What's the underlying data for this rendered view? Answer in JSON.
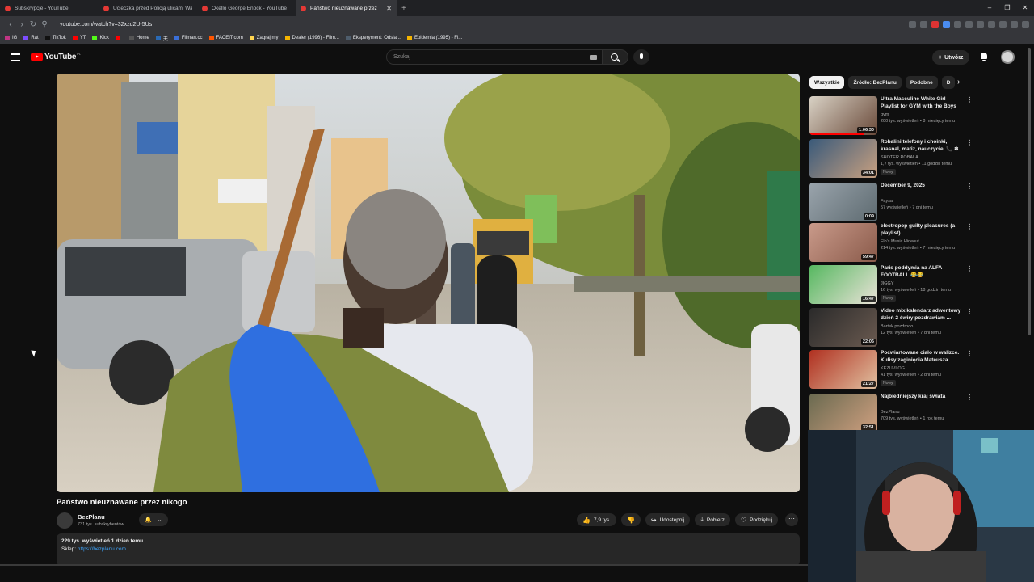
{
  "browser": {
    "tabs": [
      {
        "title": "Subskrypcje - YouTube",
        "active": false
      },
      {
        "title": "Ucieczka przed Policją ulicami Warsz",
        "active": false
      },
      {
        "title": "Okello George Enock - YouTube",
        "active": false
      },
      {
        "title": "Państwo nieuznawane przez",
        "active": true
      }
    ],
    "new_tab_symbol": "+",
    "window_controls": [
      "–",
      "❐",
      "✕"
    ],
    "url": "youtube.com/watch?v=32xzd2U-5Us",
    "bookmarks": [
      "IG",
      "Rat",
      "TikTok",
      "YT",
      "Kick",
      "",
      "Home",
      "天",
      "Filman.cc",
      "FACEIT.com",
      "Zagraj.my",
      "Dealer (1996) - Film...",
      "Eksperyment: Odsia...",
      "Epidemia (1995) - Fi..."
    ],
    "bookmark_colors": [
      "#c13584",
      "#7c4dff",
      "#111111",
      "#ff0000",
      "#53fc18",
      "#ff0000",
      "#555555",
      "#2a6ab5",
      "#3a6fd8",
      "#ff5500",
      "#ffd54f",
      "#f4b400",
      "#4e5d6c",
      "#f4b400"
    ]
  },
  "youtube": {
    "logo_text": "YouTube",
    "country": "PL",
    "search_placeholder": "Szukaj",
    "create_label": "Utwórz"
  },
  "video": {
    "title": "Państwo nieuznawane przez nikogo",
    "channel": "BezPlanu",
    "subscribers": "731 tys. subskrybentów",
    "likes": "7,9 tys.",
    "share_label": "Udostępnij",
    "download_label": "Pobierz",
    "thanks_label": "Podziękuj",
    "description_meta": "229 tys. wyświetleń  1 dzień temu",
    "shop_label": "Sklep:",
    "shop_link": "https://bezplanu.com"
  },
  "sidebar": {
    "chips": [
      "Wszystkie",
      "Źródło: BezPlanu",
      "Podobne",
      "D"
    ],
    "recommendations": [
      {
        "title": "Ultra Masculine White Girl Playlist for GYM with the Boys",
        "channel": "gym",
        "meta": "200 tys. wyświetleń • 8 miesięcy temu",
        "duration": "1:06:30",
        "badge": "",
        "watched_fraction": 0.8,
        "thumb_colors": [
          "#d9d2c5",
          "#6a4a3a"
        ]
      },
      {
        "title": "Robalini telefony i choinki, krasnal, matiz, nauczyciel 📞 ❄",
        "channel": "SHOTER ROBALA",
        "meta": "1,7 tys. wyświetleń • 11 godzin temu",
        "duration": "34:01",
        "badge": "Nowy",
        "watched_fraction": 0,
        "thumb_colors": [
          "#3a5a7a",
          "#c8a080"
        ]
      },
      {
        "title": "December 9, 2025",
        "channel": "Faysal",
        "meta": "57 wyświetleń • 7 dni temu",
        "duration": "0:09",
        "badge": "",
        "watched_fraction": 0,
        "thumb_colors": [
          "#9aa4ac",
          "#5d6a70"
        ]
      },
      {
        "title": "electropop guilty pleasures (a playlist)",
        "channel": "Flo's Music Hideout",
        "meta": "214 tys. wyświetleń • 7 miesięcy temu",
        "duration": "59:47",
        "badge": "",
        "watched_fraction": 0,
        "thumb_colors": [
          "#c99a8a",
          "#8a5a4a"
        ]
      },
      {
        "title": "Paris poddymia na ALFA FOOTBALL 😂😂",
        "channel": "JIGGY",
        "meta": "16 tys. wyświetleń • 18 godzin temu",
        "duration": "16:47",
        "badge": "Nowy",
        "watched_fraction": 0,
        "thumb_colors": [
          "#56b860",
          "#eae2d8"
        ]
      },
      {
        "title": "Video mix kalendarz adwentowy dzień 2 świry pozdrawiam ...",
        "channel": "Bartek pozdrooo",
        "meta": "12 tys. wyświetleń • 7 dni temu",
        "duration": "22:06",
        "badge": "",
        "watched_fraction": 0,
        "thumb_colors": [
          "#2a2a2a",
          "#6a5a50"
        ]
      },
      {
        "title": "Poćwiartowane ciało w walizce. Kulisy zaginięcia Mateusza ...",
        "channel": "KEZUVLOG",
        "meta": "41 tys. wyświetleń • 2 dni temu",
        "duration": "21:27",
        "badge": "Nowy",
        "watched_fraction": 0,
        "thumb_colors": [
          "#b03020",
          "#e0c0a0"
        ]
      },
      {
        "title": "Najbiedniejszy kraj świata",
        "channel": "BezPlanu",
        "meta": "709 tys. wyświetleń • 1 rok temu",
        "duration": "32:51",
        "badge": "",
        "watched_fraction": 0,
        "thumb_colors": [
          "#6a6a50",
          "#d0a080"
        ]
      }
    ]
  }
}
